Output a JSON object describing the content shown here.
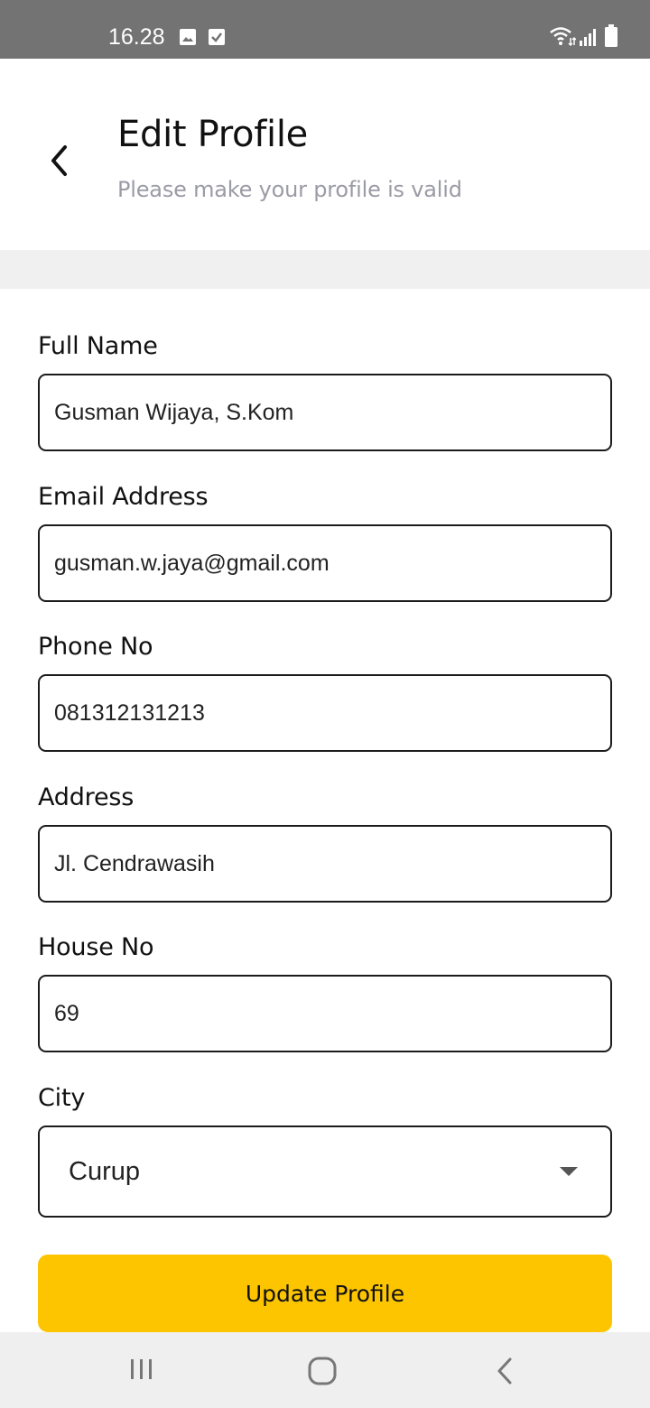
{
  "status_bar": {
    "time": "16.28",
    "icons": [
      "gallery-icon",
      "check-icon",
      "wifi-icon",
      "signal-icon",
      "battery-icon"
    ]
  },
  "header": {
    "title": "Edit Profile",
    "subtitle": "Please make your profile is valid",
    "back_icon": "chevron-left-icon"
  },
  "form": {
    "full_name": {
      "label": "Full Name",
      "value": "Gusman Wijaya, S.Kom"
    },
    "email": {
      "label": "Email Address",
      "value": "gusman.w.jaya@gmail.com"
    },
    "phone": {
      "label": "Phone No",
      "value": "081312131213"
    },
    "address": {
      "label": "Address",
      "value": "Jl. Cendrawasih"
    },
    "house_no": {
      "label": "House No",
      "value": "69"
    },
    "city": {
      "label": "City",
      "value": "Curup"
    },
    "submit_label": "Update Profile"
  },
  "nav_bar": {
    "icons": [
      "recents-icon",
      "home-icon",
      "back-icon"
    ]
  },
  "colors": {
    "accent": "#fcc500",
    "status_bar": "#737373",
    "subtitle": "#9b9ba6",
    "divider": "#f0f0f0",
    "nav_bar": "#efefef"
  }
}
